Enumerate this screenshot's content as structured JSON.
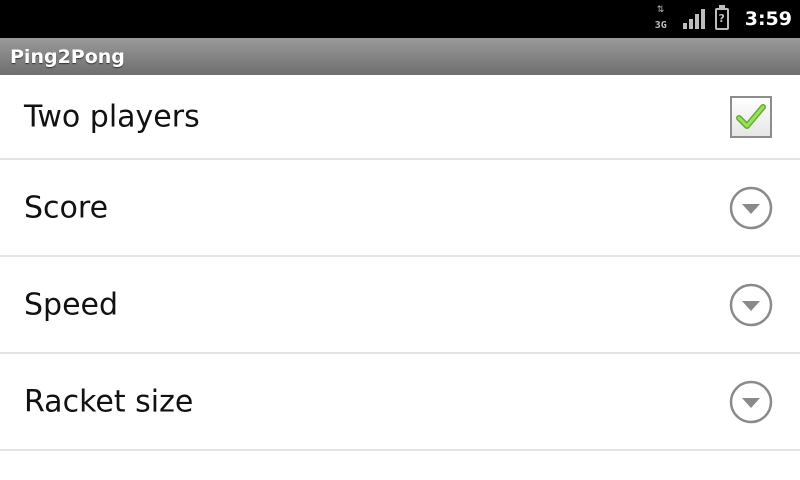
{
  "status_bar": {
    "network": "3G",
    "battery_symbol": "?",
    "time": "3:59"
  },
  "app": {
    "title": "Ping2Pong"
  },
  "preferences": [
    {
      "label": "Two players",
      "control": "checkbox",
      "checked": true
    },
    {
      "label": "Score",
      "control": "dropdown-icon"
    },
    {
      "label": "Speed",
      "control": "dropdown-icon"
    },
    {
      "label": "Racket size",
      "control": "dropdown-icon"
    }
  ],
  "colors": {
    "check_green": "#7ac943",
    "icon_gray": "#8a8a8a",
    "status_bar_bg": "#000000"
  }
}
